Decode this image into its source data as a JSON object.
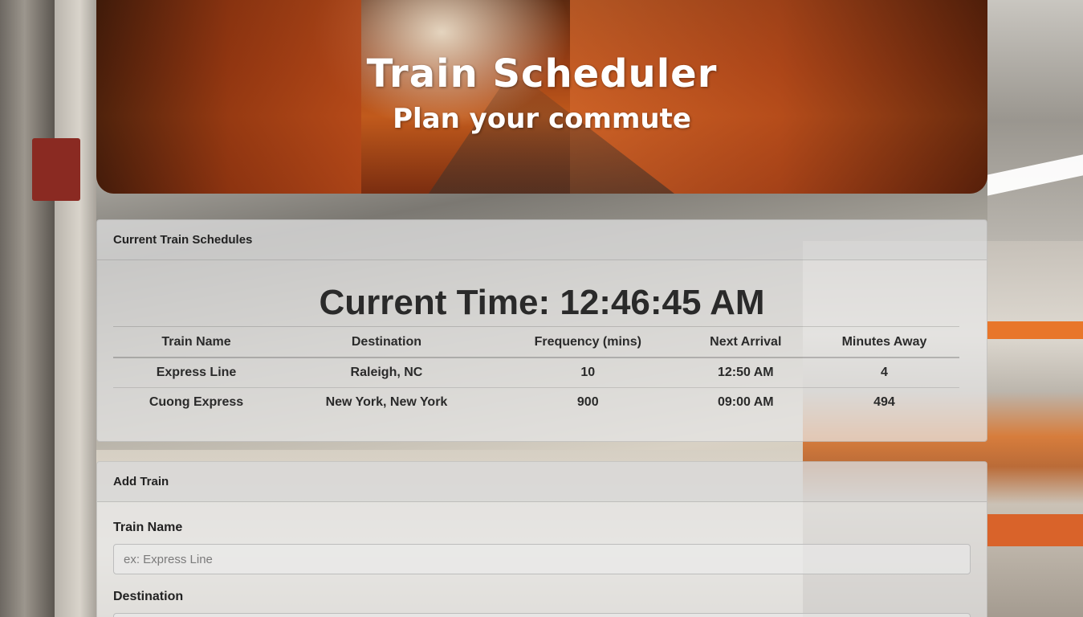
{
  "header": {
    "title": "Train Scheduler",
    "subtitle": "Plan your commute"
  },
  "schedule": {
    "card_title": "Current Train Schedules",
    "current_time_label": "Current Time: 12:46:45 AM",
    "columns": [
      "Train Name",
      "Destination",
      "Frequency (mins)",
      "Next Arrival",
      "Minutes Away"
    ],
    "rows": [
      [
        "Express Line",
        "Raleigh, NC",
        "10",
        "12:50 AM",
        "4"
      ],
      [
        "Cuong Express",
        "New York, New York",
        "900",
        "09:00 AM",
        "494"
      ]
    ]
  },
  "add_train": {
    "card_title": "Add Train",
    "train_name_label": "Train Name",
    "train_name_placeholder": "ex: Express Line",
    "destination_label": "Destination"
  }
}
